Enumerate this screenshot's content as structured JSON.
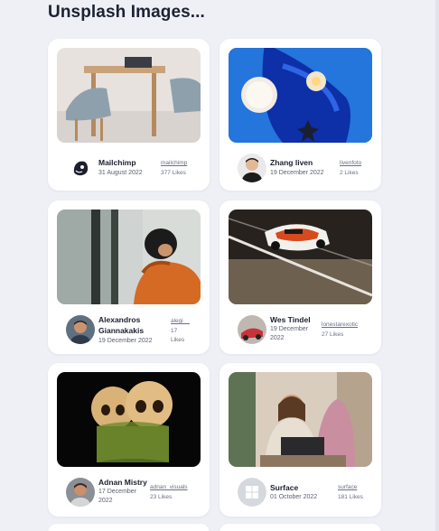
{
  "page": {
    "title": "Unsplash Images..."
  },
  "cards": [
    {
      "name": "Mailchimp",
      "date": "31 August 2022",
      "handle": "mailchimp",
      "likes": "377 Likes",
      "photo_icon": "table-chairs-photo",
      "avatar_icon": "mailchimp-logo-avatar"
    },
    {
      "name": "Zhang liven",
      "date": "19 December 2022",
      "handle": "livenfoto",
      "likes": "2 Likes",
      "photo_icon": "candles-blue-tray-photo",
      "avatar_icon": "person-avatar"
    },
    {
      "name": "Alexandros Giannakakis",
      "date": "19 December 2022",
      "handle": "alegi__",
      "likes": "17 Likes",
      "photo_icon": "person-window-photo",
      "avatar_icon": "person-avatar"
    },
    {
      "name": "Wes Tindel",
      "date": "19 December 2022",
      "handle": "lonestarexotic",
      "likes": "27 Likes",
      "photo_icon": "race-car-photo",
      "avatar_icon": "car-avatar"
    },
    {
      "name": "Adnan Mistry",
      "date": "17 December 2022",
      "handle": "adnan_visuals",
      "likes": "23 Likes",
      "photo_icon": "skulls-photo",
      "avatar_icon": "person-avatar"
    },
    {
      "name": "Surface",
      "date": "01 October 2022",
      "handle": "surface",
      "likes": "181 Likes",
      "photo_icon": "laptop-office-photo",
      "avatar_icon": "windows-logo-avatar"
    }
  ],
  "colors": {
    "background": "#eef0f6",
    "card": "#ffffff",
    "title": "#1b2233"
  }
}
